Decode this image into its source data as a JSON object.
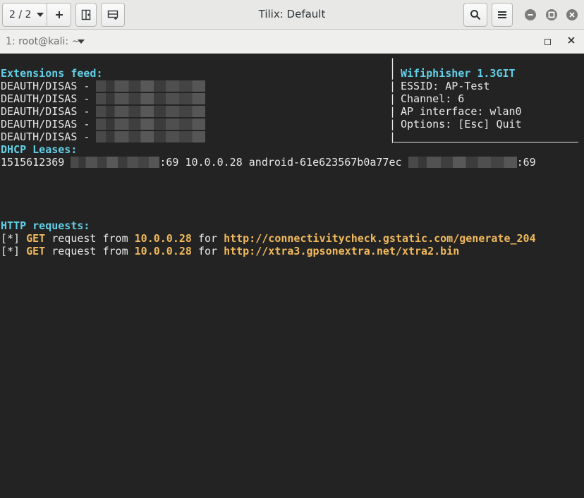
{
  "window": {
    "title": "Tilix: Default",
    "session_selector": "2 / 2"
  },
  "tab": {
    "title": "1: root@kali: ~"
  },
  "terminal": {
    "ext_heading": "Extensions feed:",
    "deauth_label": "DEAUTH/DISAS -",
    "deauth_rows": 5,
    "wifi_title": "Wifiphisher 1.3GIT",
    "info": [
      "ESSID: AP-Test",
      "Channel: 6",
      "AP interface: wlan0",
      "Options: [Esc] Quit"
    ],
    "separator_char": "|",
    "dhcp_heading": "DHCP Leases:",
    "dhcp_lease": {
      "timestamp": "1515612369",
      "mac_suffix_1": ":69",
      "ip": "10.0.0.28",
      "hostname": "android-61e623567b0a77ec",
      "mac_suffix_2": ":69"
    },
    "http_heading": "HTTP requests:",
    "http_requests": [
      {
        "marker": "[*]",
        "method": "GET",
        "text_request": "request from",
        "ip": "10.0.0.28",
        "text_for": "for",
        "url": "http://connectivitycheck.gstatic.com/generate_204"
      },
      {
        "marker": "[*]",
        "method": "GET",
        "text_request": "request from",
        "ip": "10.0.0.28",
        "text_for": "for",
        "url": "http://xtra3.gpsonextra.net/xtra2.bin"
      }
    ]
  },
  "colors": {
    "terminal_bg": "#232323",
    "heading_cyan": "#61cfe6",
    "highlight_orange": "#f0b95c",
    "text": "#e8e8e8"
  }
}
